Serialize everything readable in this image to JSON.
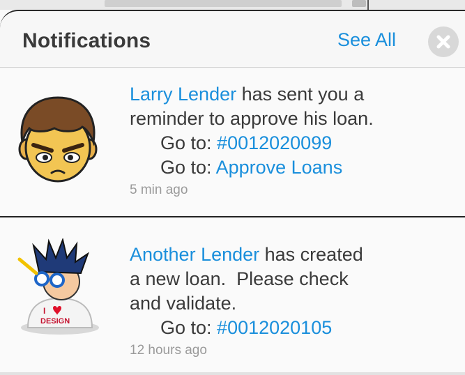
{
  "header": {
    "title": "Notifications",
    "see_all": "See All"
  },
  "notifications": [
    {
      "sender": "Larry Lender",
      "line1_rest": " has sent you a",
      "line2": "reminder to approve his loan.",
      "goto_prefix_1": "Go to: ",
      "goto_link_1": "#0012020099",
      "goto_prefix_2": "Go to: ",
      "goto_link_2": "Approve Loans",
      "time": "5 min ago",
      "avatar_icon": "angry-boy-avatar-icon"
    },
    {
      "sender": "Another Lender",
      "line1_rest": " has created",
      "line2": "a new loan.  Please check",
      "line3": "and validate.",
      "goto_prefix_1": "Go to: ",
      "goto_link_1": "#0012020105",
      "time": "12 hours ago",
      "avatar_icon": "designer-avatar-icon",
      "avatar_shirt_text_1": "I",
      "avatar_shirt_text_2": "DESIGN"
    }
  ],
  "colors": {
    "link": "#1a8fdc",
    "text": "#3a3a3a",
    "time": "#9a9a9a"
  }
}
